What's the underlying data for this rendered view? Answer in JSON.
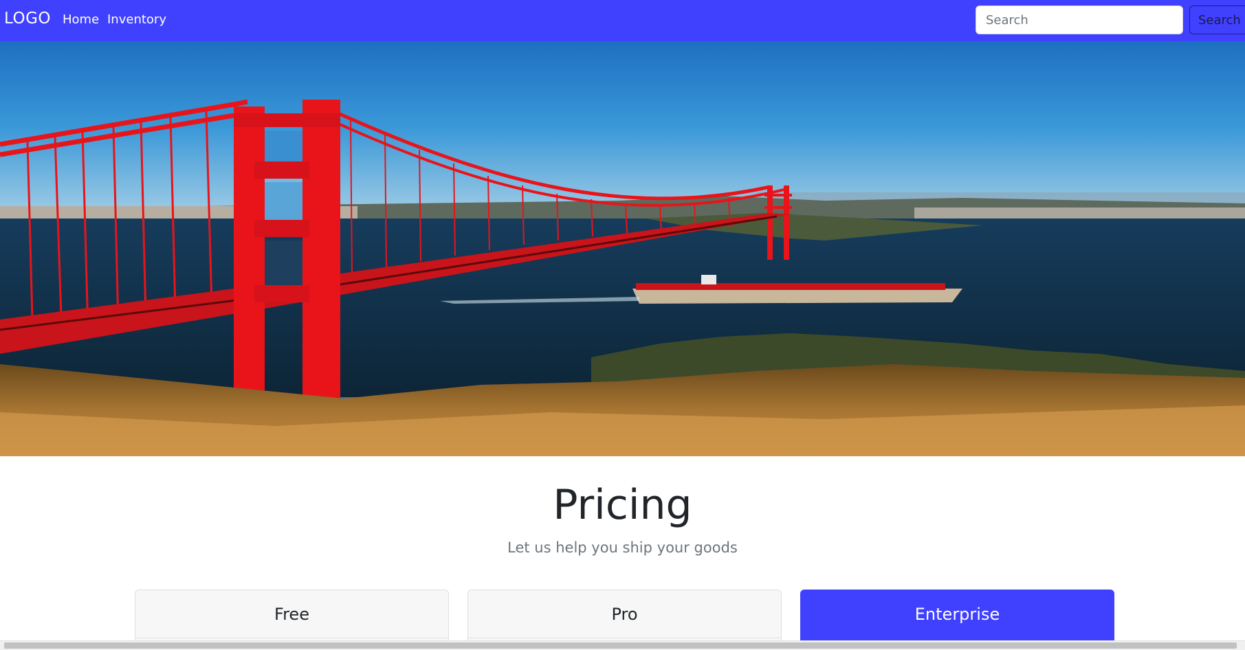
{
  "navbar": {
    "brand": "LOGO",
    "links": [
      {
        "label": "Home"
      },
      {
        "label": "Inventory"
      }
    ],
    "search": {
      "placeholder": "Search",
      "button_label": "Search"
    },
    "color": "#4040ff"
  },
  "hero": {
    "image_subject": "golden-gate-bridge-with-container-ship"
  },
  "pricing": {
    "title": "Pricing",
    "subtitle": "Let us help you ship your goods",
    "plans": [
      {
        "name": "Free"
      },
      {
        "name": "Pro"
      },
      {
        "name": "Enterprise",
        "highlighted": true
      }
    ]
  },
  "colors": {
    "primary": "#4040ff",
    "bridge": "#e8141a",
    "text": "#212529",
    "muted": "#6c757d"
  }
}
